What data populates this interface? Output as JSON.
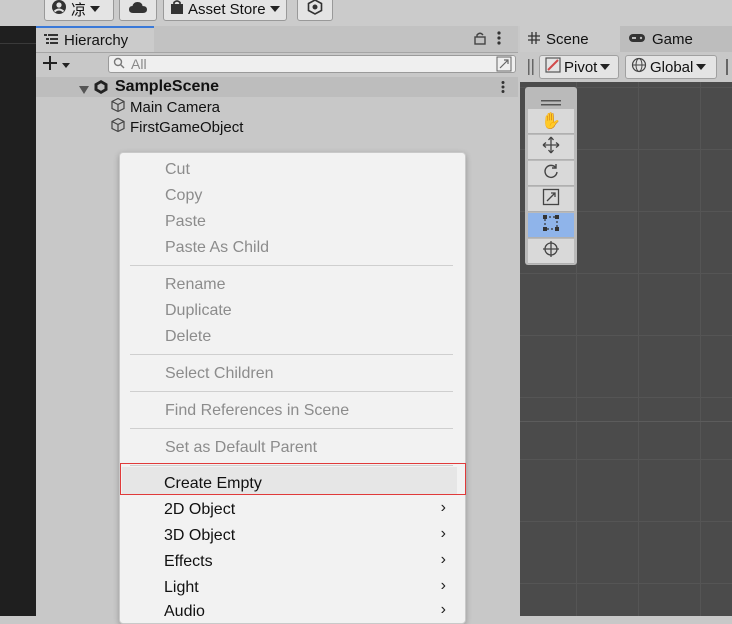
{
  "toolbar": {
    "account_label": "凉",
    "asset_store_label": "Asset Store"
  },
  "hierarchy": {
    "tab_title": "Hierarchy",
    "search_placeholder": "All",
    "scene_name": "SampleScene",
    "objects": [
      "Main Camera",
      "FirstGameObject"
    ]
  },
  "context_menu": {
    "items": {
      "cut": "Cut",
      "copy": "Copy",
      "paste": "Paste",
      "paste_as_child": "Paste As Child",
      "rename": "Rename",
      "duplicate": "Duplicate",
      "delete": "Delete",
      "select_children": "Select Children",
      "find_references": "Find References in Scene",
      "set_default_parent": "Set as Default Parent",
      "create_empty": "Create Empty",
      "object_2d": "2D Object",
      "object_3d": "3D Object",
      "effects": "Effects",
      "light": "Light",
      "audio": "Audio"
    },
    "submenu_arrow": "›"
  },
  "scene_view": {
    "tabs": [
      "Scene",
      "Game"
    ],
    "pivot_label": "Pivot",
    "global_label": "Global"
  },
  "colors": {
    "highlight_box": "#e03a3a",
    "active_tool": "#8fb4ea",
    "tab_accent": "#3a79d8"
  }
}
